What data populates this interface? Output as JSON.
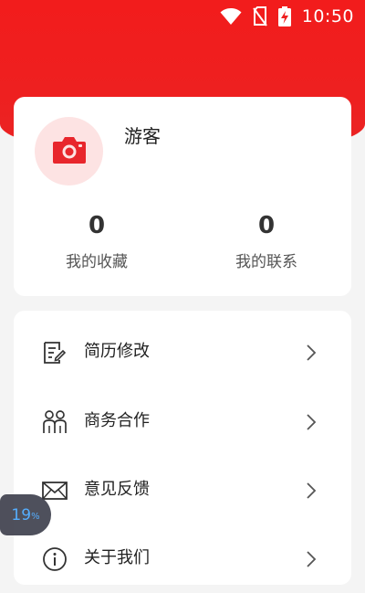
{
  "status_bar": {
    "time": "10:50",
    "icons": [
      "wifi-icon",
      "no-sim-icon",
      "battery-charging-icon"
    ]
  },
  "profile": {
    "avatar_icon": "camera-icon",
    "username": "游客",
    "stats": [
      {
        "value": "0",
        "label": "我的收藏"
      },
      {
        "value": "0",
        "label": "我的联系"
      }
    ]
  },
  "menu": {
    "items": [
      {
        "label": "简历修改",
        "icon": "resume-edit-icon"
      },
      {
        "label": "商务合作",
        "icon": "partners-icon"
      },
      {
        "label": "意见反馈",
        "icon": "mail-icon"
      },
      {
        "label": "关于我们",
        "icon": "info-icon"
      }
    ]
  },
  "floating_badge": {
    "value": "19",
    "unit": "%"
  },
  "colors": {
    "brand_red": "#ee2020",
    "avatar_bg": "#fde3e3",
    "badge_bg": "#40424f",
    "badge_text": "#47a8ff"
  }
}
